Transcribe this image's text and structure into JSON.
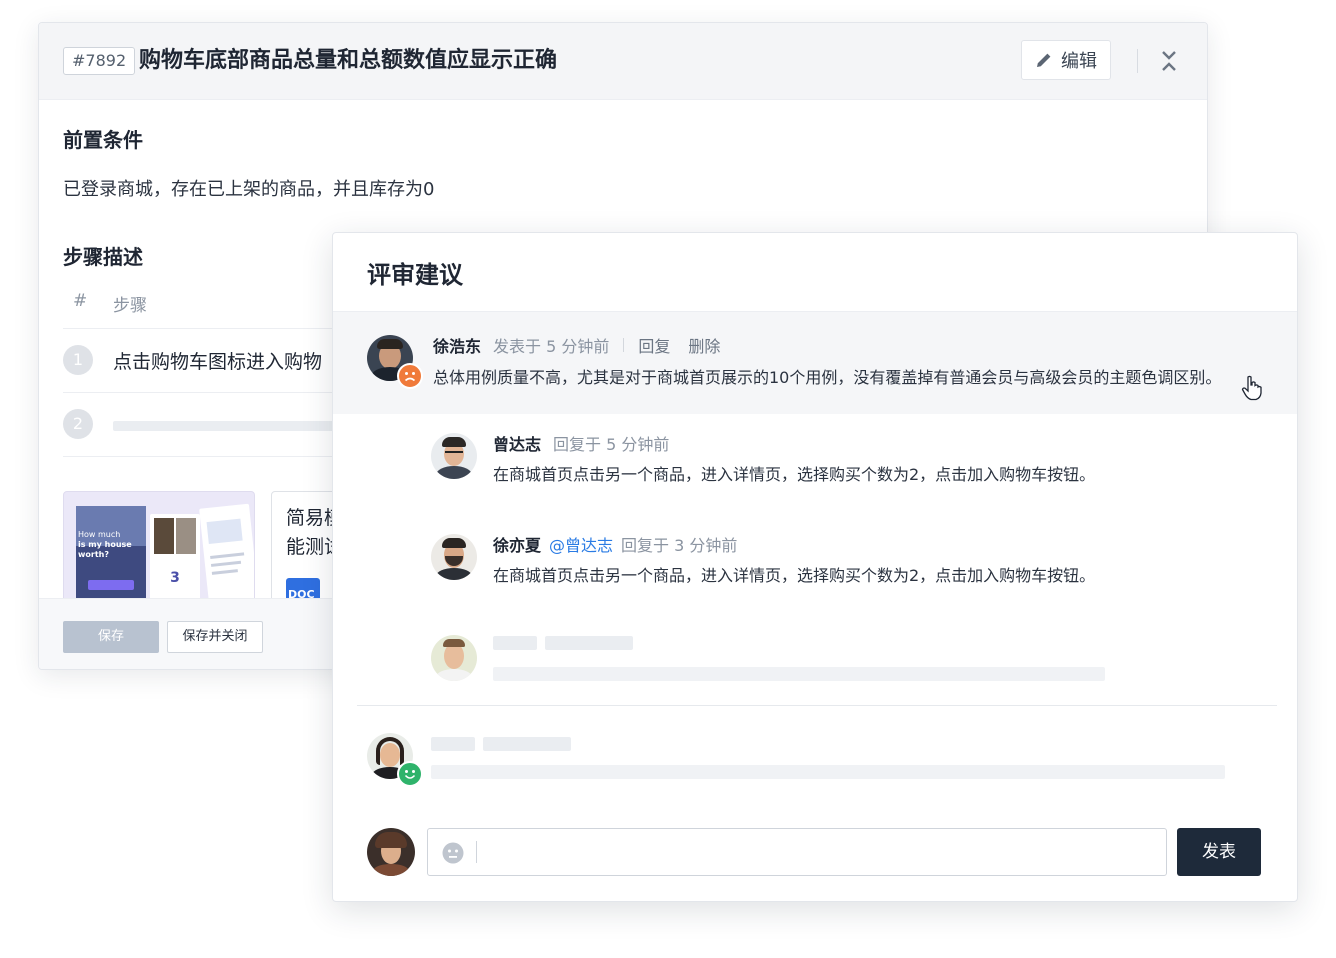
{
  "case": {
    "id": "#7892",
    "title": "购物车底部商品总量和总额数值应显示正确",
    "edit_label": "编辑",
    "precondition_title": "前置条件",
    "precondition_text": "已登录商城，存在已上架的商品，并且库存为0",
    "steps_title": "步骤描述",
    "steps_header": {
      "hash": "#",
      "label": "步骤"
    },
    "steps": [
      {
        "num": "1",
        "text": "点击购物车图标进入购物"
      },
      {
        "num": "2",
        "text": ""
      }
    ],
    "attachments": [
      {
        "type": "image",
        "caption_lines": [
          "How much",
          "is my house",
          "worth?"
        ],
        "badge": "3"
      },
      {
        "type": "doc",
        "name": "简易模能测试",
        "icon_label": "DOC"
      }
    ],
    "footer": {
      "save_label": "保存",
      "save_close_label": "保存并关闭"
    }
  },
  "review": {
    "title": "评审建议",
    "comments": [
      {
        "author": "徐浩东",
        "meta": "发表于 5 分钟前",
        "reply_label": "回复",
        "delete_label": "删除",
        "text": "总体用例质量不高，尤其是对于商城首页展示的10个用例，没有覆盖掉有普通会员与高级会员的主题色调区别。",
        "mood": "sad",
        "highlighted": true
      },
      {
        "author": "曾达志",
        "meta": "回复于 5 分钟前",
        "text": "在商城首页点击另一个商品，进入详情页，选择购买个数为2，点击加入购物车按钮。"
      },
      {
        "author": "徐亦夏",
        "mention": "@曾达志",
        "meta": "回复于 3 分钟前",
        "text": "在商城首页点击另一个商品，进入详情页，选择购买个数为2，点击加入购物车按钮。"
      }
    ],
    "publish_label": "发表",
    "input_placeholder": ""
  },
  "colors": {
    "accent_dark": "#1e2a3a",
    "mention": "#2a7be4",
    "sad_badge": "#f07a3a",
    "happy_badge": "#2fb36b"
  }
}
